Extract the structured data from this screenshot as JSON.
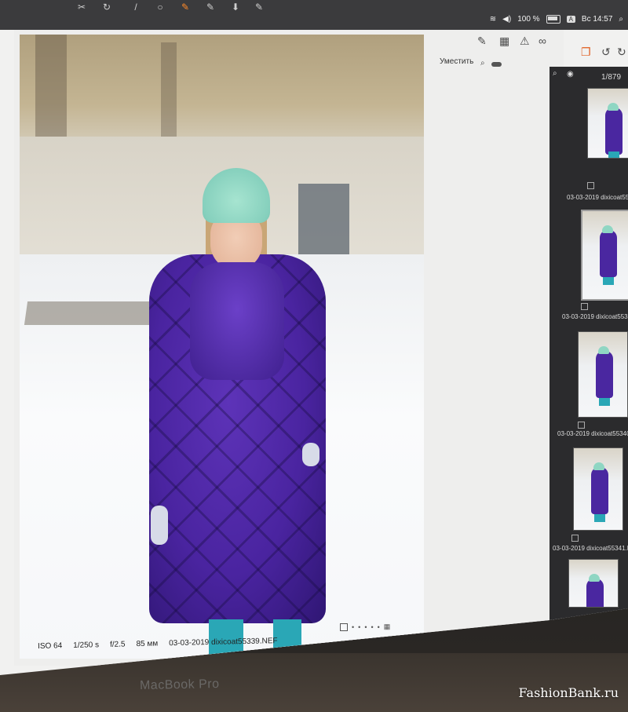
{
  "menubar": {
    "keyboard_badge": "A",
    "battery_percent": "100 %",
    "clock": "Вс 14:57"
  },
  "toolbar": {
    "fit_label": "Уместить",
    "icons": [
      "edit-icon",
      "grid-icon",
      "warning-icon",
      "glasses-icon",
      "stack-icon",
      "rotate-left-icon",
      "rotate-right-icon"
    ]
  },
  "photo_info": {
    "iso": "ISO 64",
    "shutter": "1/250 s",
    "aperture": "f/2.5",
    "focal": "85 мм",
    "filename": "03-03-2019 dixicoat55339.NEF"
  },
  "filmstrip": {
    "counter": "1/879",
    "items": [
      {
        "name": "03-03-2019 dixicoat55"
      },
      {
        "name": "03-03-2019 dixicoat553"
      },
      {
        "name": "03-03-2019 dixicoat55340"
      },
      {
        "name": "03-03-2019 dixicoat55341.N"
      },
      {
        "name": ""
      }
    ]
  },
  "device": {
    "label": "MacBook Pro"
  },
  "watermark": "FashionBank.ru",
  "colors": {
    "coat": "#4a24a0",
    "hat": "#86d0bd",
    "pants": "#2aa7b6",
    "menubar": "#3b3b3d"
  }
}
